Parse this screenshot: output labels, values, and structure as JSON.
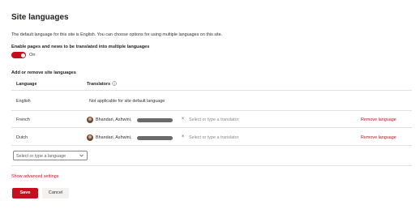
{
  "page_title": "Site languages",
  "description": "The default language for this site is English. You can choose options for using multiple languages on this site.",
  "translation_toggle": {
    "label": "Enable pages and news to be translated into multiple languages",
    "state": "On",
    "enabled": true
  },
  "languages_section": {
    "label": "Add or remove site languages",
    "columns": {
      "language": "Language",
      "translators": "Translators"
    },
    "rows": [
      {
        "language": "English",
        "translators_text": "Not applicable for site default language"
      },
      {
        "language": "French",
        "translator_name": "Bhandari, Ashwini,",
        "translator_placeholder": "Select or type a translator",
        "remove_label": "Remove language"
      },
      {
        "language": "Dutch",
        "translator_name": "Bhandari, Ashwini,",
        "translator_placeholder": "Select or type a translator",
        "remove_label": "Remove language"
      }
    ],
    "add_language_placeholder": "Select or type a language"
  },
  "advanced_link": "Show advanced settings",
  "actions": {
    "save_label": "Save",
    "cancel_label": "Cancel"
  },
  "colors": {
    "accent": "#c50f1f",
    "divider": "#e1dfdd"
  },
  "icons": {
    "info": "info-icon",
    "remove_person": "close-icon",
    "dropdown": "chevron-down-icon"
  }
}
